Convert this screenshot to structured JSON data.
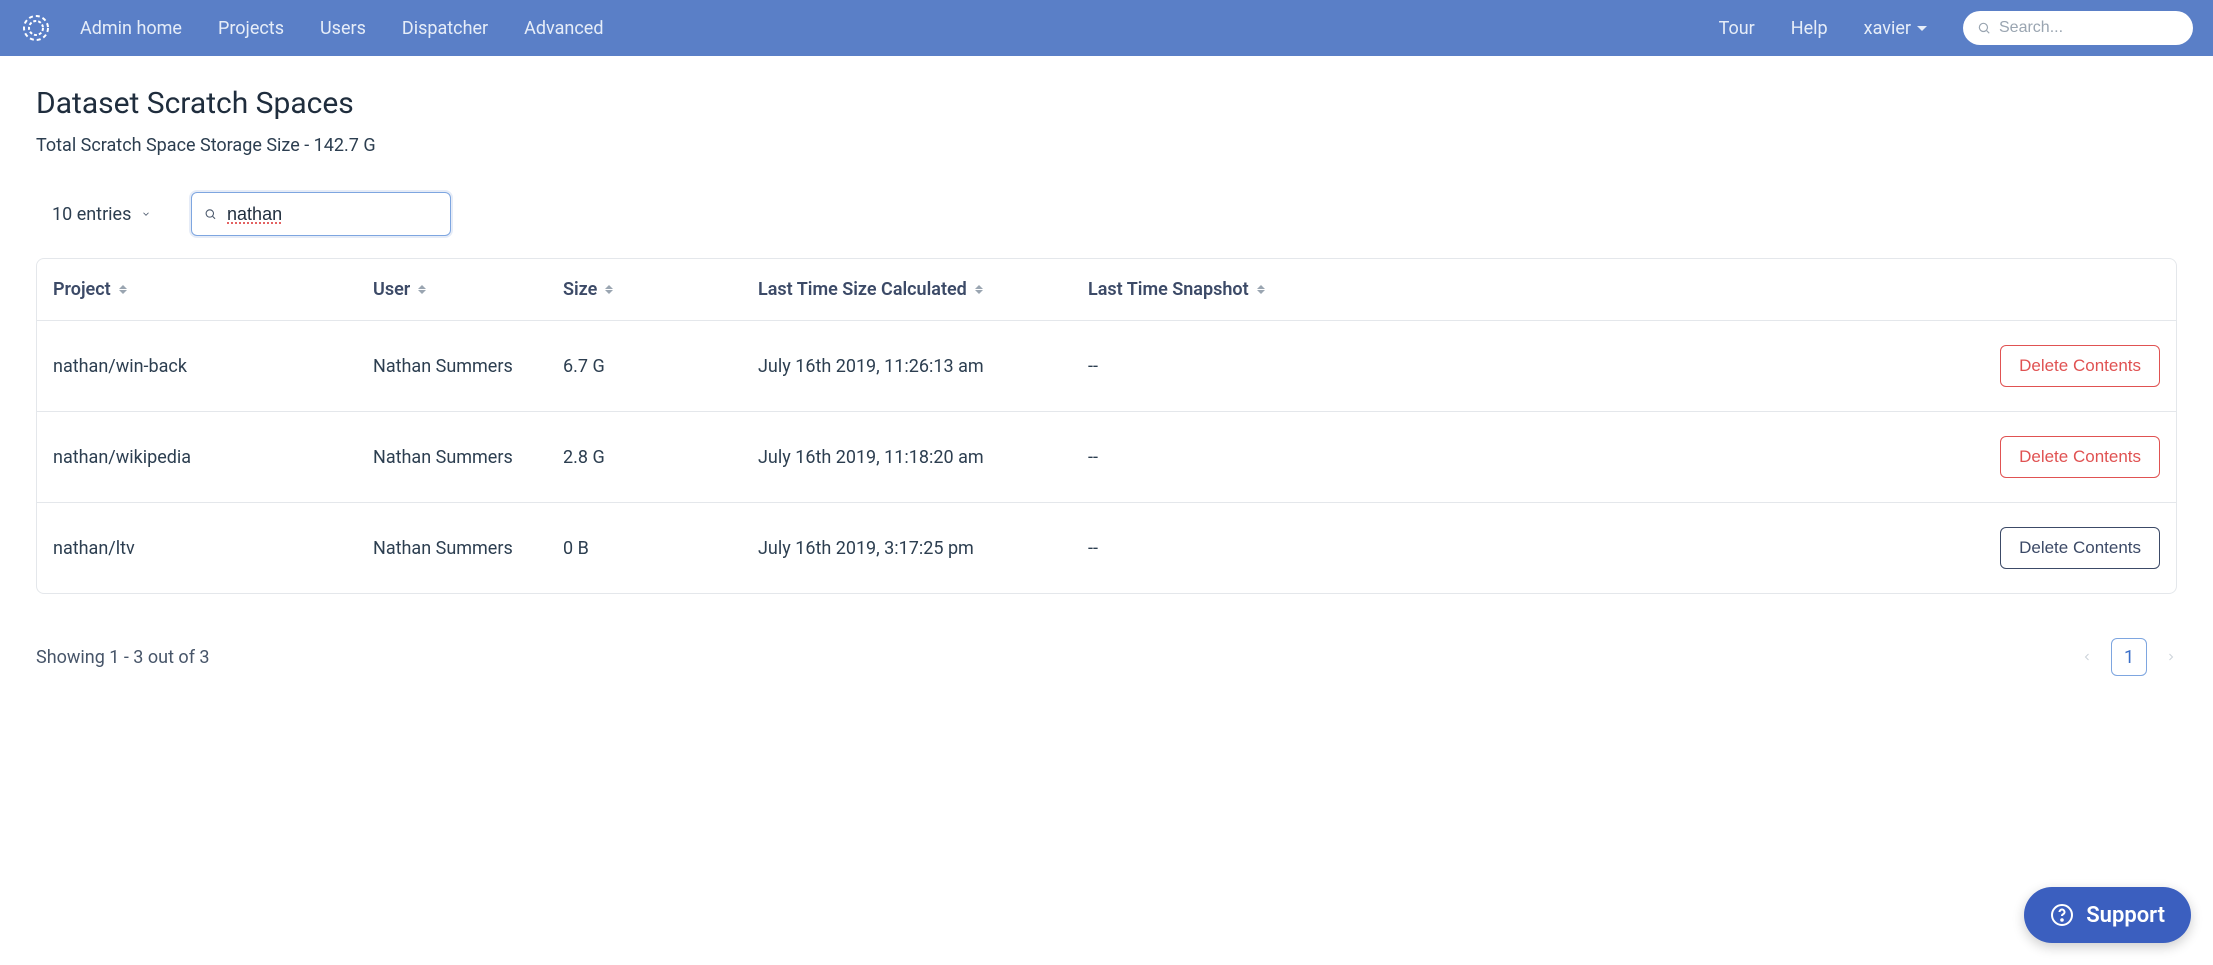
{
  "nav": {
    "links": [
      "Admin home",
      "Projects",
      "Users",
      "Dispatcher",
      "Advanced"
    ],
    "tour": "Tour",
    "help": "Help",
    "user": "xavier",
    "search_placeholder": "Search..."
  },
  "page": {
    "title": "Dataset Scratch Spaces",
    "subtitle": "Total Scratch Space Storage Size - 142.7 G"
  },
  "controls": {
    "entries_label": "10 entries",
    "filter_value": "nathan"
  },
  "table": {
    "headers": {
      "project": "Project",
      "user": "User",
      "size": "Size",
      "calculated": "Last Time Size Calculated",
      "snapshot": "Last Time Snapshot"
    },
    "rows": [
      {
        "project": "nathan/win-back",
        "user": "Nathan Summers",
        "size": "6.7 G",
        "calculated": "July 16th 2019, 11:26:13 am",
        "snapshot": "--",
        "action_label": "Delete Contents",
        "action_style": "danger"
      },
      {
        "project": "nathan/wikipedia",
        "user": "Nathan Summers",
        "size": "2.8 G",
        "calculated": "July 16th 2019, 11:18:20 am",
        "snapshot": "--",
        "action_label": "Delete Contents",
        "action_style": "danger"
      },
      {
        "project": "nathan/ltv",
        "user": "Nathan Summers",
        "size": "0 B",
        "calculated": "July 16th 2019, 3:17:25 pm",
        "snapshot": "--",
        "action_label": "Delete Contents",
        "action_style": "neutral"
      }
    ]
  },
  "footer": {
    "showing": "Showing 1 - 3 out of 3",
    "page": "1"
  },
  "support": {
    "label": "Support"
  }
}
